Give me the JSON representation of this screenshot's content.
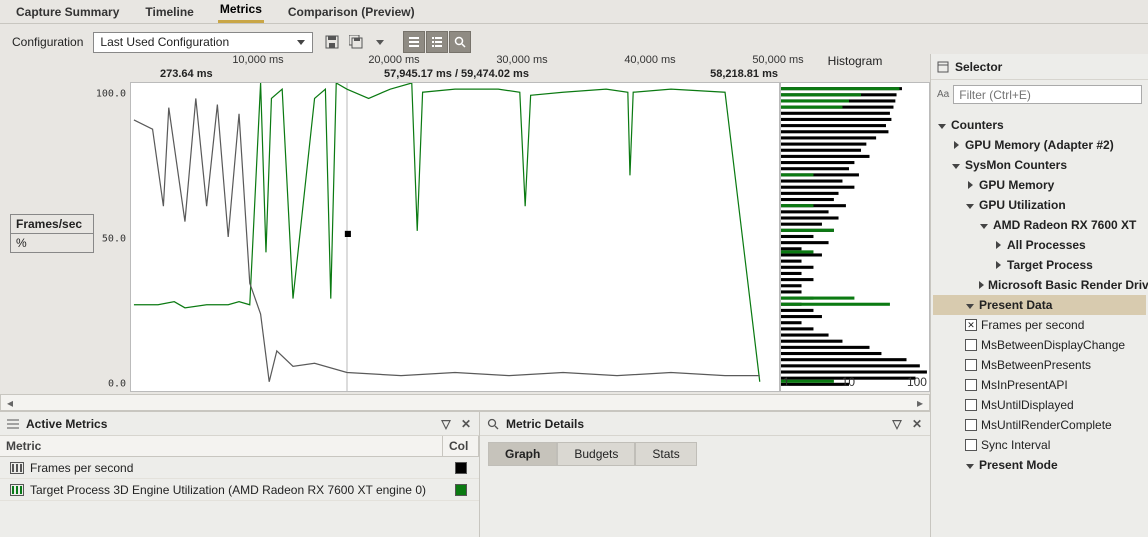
{
  "tabs": {
    "capture": "Capture Summary",
    "timeline": "Timeline",
    "metrics": "Metrics",
    "comparison": "Comparison (Preview)"
  },
  "config": {
    "label": "Configuration",
    "selected": "Last Used Configuration"
  },
  "axis": {
    "y100": "100.0",
    "y50": "50.0",
    "y0": "0.0",
    "fs_top": "Frames/sec",
    "fs_bottom": "%"
  },
  "time_ticks": {
    "t1": "10,000 ms",
    "t2": "20,000 ms",
    "t3": "30,000 ms",
    "t4": "40,000 ms",
    "t5": "50,000 ms"
  },
  "status": {
    "left": "273.64 ms",
    "mid": "57,945.17 ms / 59,474.02 ms",
    "right": "58,218.81 ms"
  },
  "hist": {
    "title": "Histogram",
    "t1": "1",
    "t2": "10",
    "t3": "100"
  },
  "panels": {
    "active": {
      "title": "Active Metrics",
      "col_metric": "Metric",
      "col_color": "Col",
      "rows": [
        {
          "name": "Frames per second",
          "color": "#000000"
        },
        {
          "name": "Target Process 3D Engine Utilization (AMD Radeon RX 7600 XT engine 0)",
          "color": "#0b7a12"
        }
      ]
    },
    "details": {
      "title": "Metric Details",
      "tabs": {
        "graph": "Graph",
        "budgets": "Budgets",
        "stats": "Stats"
      }
    }
  },
  "selector": {
    "title": "Selector",
    "filter_placeholder": "Filter (Ctrl+E)",
    "aa": "Aa",
    "tree": [
      {
        "lbl": "Counters",
        "bold": true,
        "indent": 0,
        "exp": "down"
      },
      {
        "lbl": "GPU Memory (Adapter #2)",
        "bold": true,
        "indent": 1,
        "exp": "right"
      },
      {
        "lbl": "SysMon Counters",
        "bold": true,
        "indent": 1,
        "exp": "down"
      },
      {
        "lbl": "GPU Memory",
        "bold": true,
        "indent": 2,
        "exp": "right"
      },
      {
        "lbl": "GPU Utilization",
        "bold": true,
        "indent": 2,
        "exp": "down"
      },
      {
        "lbl": "AMD Radeon RX 7600 XT",
        "bold": true,
        "indent": 3,
        "exp": "down"
      },
      {
        "lbl": "All Processes",
        "bold": true,
        "indent": 4,
        "exp": "right"
      },
      {
        "lbl": "Target Process",
        "bold": true,
        "indent": 4,
        "exp": "right"
      },
      {
        "lbl": "Microsoft Basic Render Driver",
        "bold": true,
        "indent": 3,
        "exp": "right"
      },
      {
        "lbl": "Present Data",
        "bold": true,
        "indent": 2,
        "exp": "down",
        "hl": true
      },
      {
        "lbl": "Frames per second",
        "indent": 2,
        "chk": true,
        "checked": true
      },
      {
        "lbl": "MsBetweenDisplayChange",
        "indent": 2,
        "chk": true
      },
      {
        "lbl": "MsBetweenPresents",
        "indent": 2,
        "chk": true
      },
      {
        "lbl": "MsInPresentAPI",
        "indent": 2,
        "chk": true
      },
      {
        "lbl": "MsUntilDisplayed",
        "indent": 2,
        "chk": true
      },
      {
        "lbl": "MsUntilRenderComplete",
        "indent": 2,
        "chk": true
      },
      {
        "lbl": "Sync Interval",
        "indent": 2,
        "chk": true
      },
      {
        "lbl": "Present Mode",
        "bold": true,
        "indent": 2,
        "exp": "down"
      }
    ]
  },
  "chart_data": {
    "type": "line",
    "xlabel": "ms",
    "ylabel": "",
    "ylim": [
      0,
      100
    ],
    "xlim": [
      0,
      60000
    ],
    "title": "",
    "series": [
      {
        "name": "Target Process 3D Engine Utilization (AMD Radeon RX 7600 XT engine 0)",
        "color": "#0b7a12",
        "x": [
          273,
          2500,
          4000,
          5000,
          7000,
          9000,
          10000,
          11000,
          12000,
          12500,
          13000,
          14000,
          15000,
          17000,
          18000,
          18500,
          19000,
          20000,
          22000,
          24000,
          26000,
          26500,
          27000,
          30000,
          34000,
          36000,
          36500,
          37000,
          40000,
          44000,
          46000,
          46200,
          46500,
          50000,
          55000,
          58218
        ],
        "y": [
          28,
          28,
          29,
          27,
          28,
          28,
          29,
          28,
          100,
          45,
          95,
          98,
          30,
          95,
          98,
          30,
          100,
          98,
          95,
          98,
          100,
          52,
          97,
          98,
          98,
          97,
          60,
          96,
          97,
          98,
          97,
          70,
          97,
          98,
          97,
          3
        ]
      },
      {
        "name": "Frames per second",
        "color": "#5a5a5a",
        "x": [
          273,
          2000,
          3000,
          3500,
          5000,
          6000,
          7000,
          8000,
          9000,
          10000,
          11000,
          12000,
          12800,
          13500,
          15000,
          17000,
          20000,
          25000,
          30000,
          35000,
          40000,
          45000,
          50000,
          55000,
          58218
        ],
        "y": [
          88,
          85,
          60,
          92,
          55,
          95,
          60,
          93,
          50,
          90,
          35,
          25,
          3,
          13,
          8,
          9,
          6,
          5,
          6,
          5,
          6,
          5,
          6,
          5,
          5
        ]
      }
    ],
    "histogram": {
      "type": "histogram-horizontal",
      "xscale": "log",
      "xlim": [
        1,
        150
      ],
      "series": [
        {
          "name": "Frames per second",
          "color": "#000000",
          "bins_y": [
            98,
            96,
            94,
            92,
            90,
            88,
            86,
            84,
            82,
            80,
            78,
            76,
            74,
            72,
            70,
            68,
            66,
            64,
            62,
            60,
            58,
            56,
            54,
            52,
            50,
            48,
            46,
            44,
            42,
            40,
            38,
            36,
            34,
            32,
            30,
            28,
            26,
            24,
            22,
            20,
            18,
            16,
            14,
            12,
            10,
            8,
            6,
            4,
            2
          ],
          "counts": [
            60,
            50,
            48,
            45,
            40,
            42,
            35,
            38,
            25,
            18,
            15,
            20,
            12,
            10,
            14,
            8,
            12,
            7,
            6,
            9,
            5,
            7,
            4,
            6,
            3,
            5,
            2,
            4,
            2,
            3,
            2,
            3,
            2,
            2,
            3,
            2,
            3,
            4,
            2,
            3,
            5,
            8,
            20,
            30,
            70,
            110,
            140,
            95,
            10
          ]
        },
        {
          "name": "Target Process 3D Engine Utilization",
          "color": "#0b7a12",
          "bins_y": [
            98,
            96,
            94,
            92,
            70,
            60,
            52,
            45,
            30,
            28,
            3
          ],
          "counts": [
            55,
            15,
            10,
            8,
            3,
            3,
            6,
            3,
            12,
            40,
            6
          ]
        }
      ]
    }
  }
}
